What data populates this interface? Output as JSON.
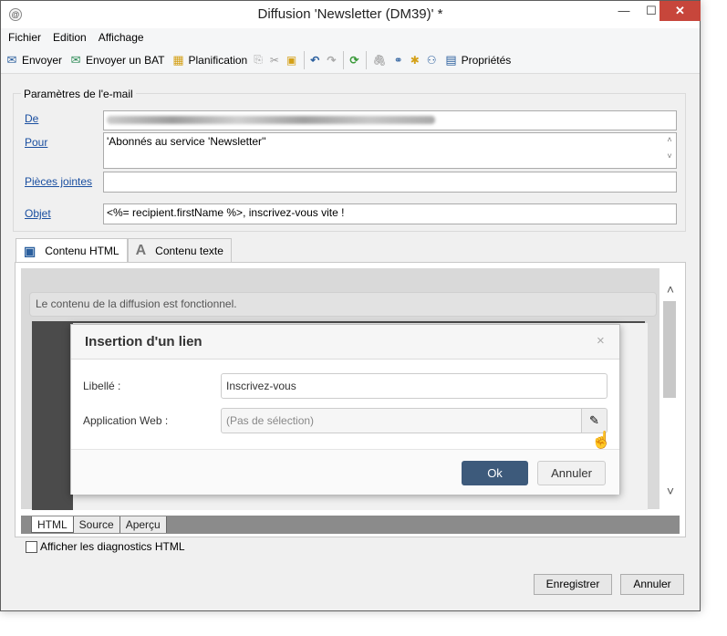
{
  "window": {
    "title": "Diffusion 'Newsletter (DM39)' *",
    "minimize": "—",
    "maximize": "☐",
    "close": "✕"
  },
  "menu": [
    "Fichier",
    "Edition",
    "Affichage"
  ],
  "toolbar": {
    "send": "Envoyer",
    "send_proof": "Envoyer un BAT",
    "schedule": "Planification",
    "properties": "Propriétés"
  },
  "email_params": {
    "group_title": "Paramètres de l'e-mail",
    "from_label": "De",
    "to_label": "Pour",
    "to_value": "'Abonnés au service 'Newsletter''",
    "attachments_label": "Pièces jointes",
    "subject_label": "Objet",
    "subject_value": "<%= recipient.firstName %>, inscrivez-vous vite !"
  },
  "tabs": [
    "Contenu HTML",
    "Contenu texte"
  ],
  "editor": {
    "status_message": "Le contenu de la diffusion est fonctionnel."
  },
  "dialog": {
    "title": "Insertion d'un lien",
    "label_label": "Libellé :",
    "label_value": "Inscrivez-vous",
    "webapp_label": "Application Web :",
    "webapp_placeholder": "(Pas de sélection)",
    "ok": "Ok",
    "cancel": "Annuler"
  },
  "modes": [
    "HTML",
    "Source",
    "Aperçu"
  ],
  "diagnostics_label": "Afficher les diagnostics HTML",
  "buttons": {
    "save": "Enregistrer",
    "cancel": "Annuler"
  },
  "colors": {
    "close_button": "#c7463b",
    "ok_button": "#3d5a7b",
    "link_label": "#1a4fa0"
  }
}
